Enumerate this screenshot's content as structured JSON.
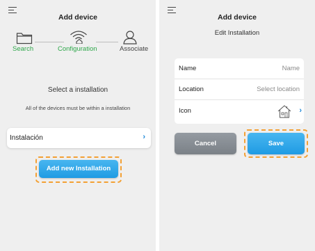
{
  "left": {
    "title": "Add device",
    "steps": [
      {
        "label": "Search",
        "icon": "folder-icon",
        "state": "done"
      },
      {
        "label": "Configuration",
        "icon": "wifi-home-icon",
        "state": "active"
      },
      {
        "label": "Associate",
        "icon": "user-icon",
        "state": "pending"
      }
    ],
    "select_title": "Select a installation",
    "select_sub": "All of the devices must be within a installation",
    "installation_label": "Instalación",
    "add_button": "Add new Installation"
  },
  "right": {
    "title": "Add device",
    "subtitle": "Edit Installation",
    "fields": [
      {
        "label": "Name",
        "placeholder": "Name"
      },
      {
        "label": "Location",
        "placeholder": "Select location"
      },
      {
        "label": "Icon"
      }
    ],
    "cancel": "Cancel",
    "save": "Save"
  },
  "colors": {
    "accent": "#1f9be3",
    "green": "#2ea74a",
    "highlight": "#f3a033",
    "panel": "#efefef"
  }
}
